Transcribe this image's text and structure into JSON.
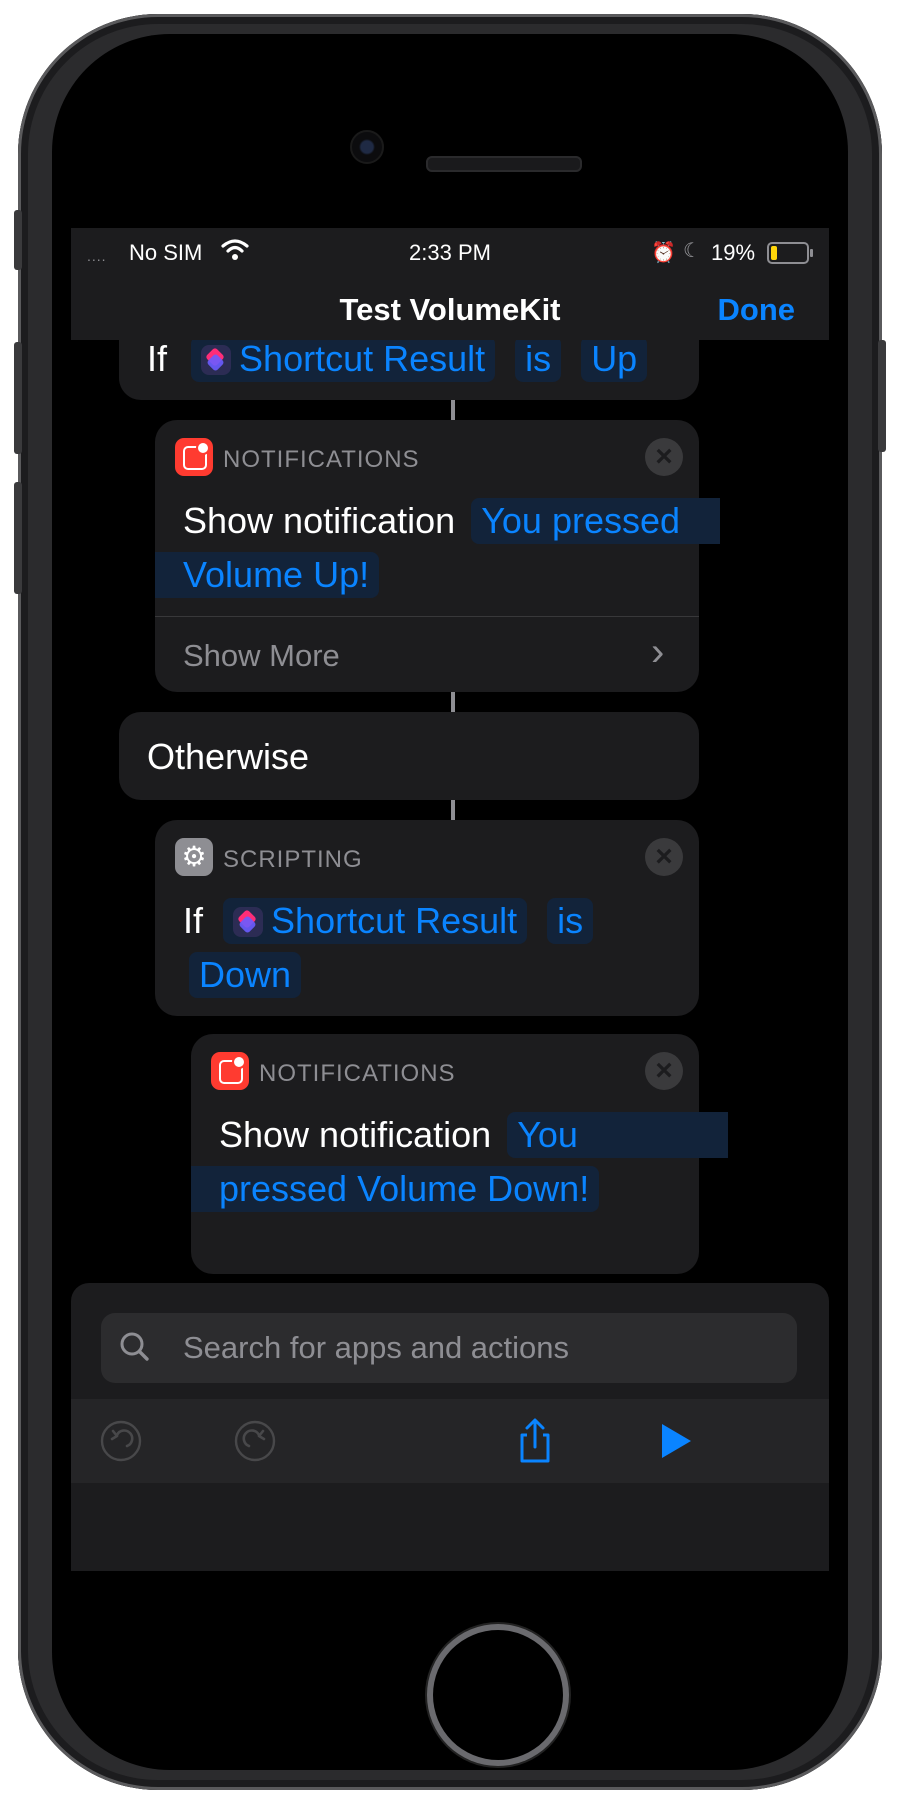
{
  "status_bar": {
    "signal": "....",
    "carrier": "No SIM",
    "time": "2:33 PM",
    "battery_percent": "19%",
    "icons": [
      "wifi-icon",
      "alarm-icon",
      "moon-icon",
      "battery-icon"
    ],
    "battery_level": 0.19
  },
  "nav": {
    "title": "Test VolumeKit",
    "done_label": "Done"
  },
  "actions": {
    "if1": {
      "keyword": "If",
      "variable": "Shortcut Result",
      "operator": "is",
      "value": "Up"
    },
    "notif1": {
      "category": "NOTIFICATIONS",
      "verb": "Show notification",
      "message_part1": "You pressed",
      "message_part2": "Volume Up!",
      "show_more": "Show More"
    },
    "otherwise": {
      "label": "Otherwise"
    },
    "if2": {
      "category": "SCRIPTING",
      "keyword": "If",
      "variable": "Shortcut Result",
      "operator": "is",
      "value": "Down"
    },
    "notif2": {
      "category": "NOTIFICATIONS",
      "verb": "Show notification",
      "message_part1": "You",
      "message_part2": "pressed Volume Down!"
    }
  },
  "search": {
    "placeholder": "Search for apps and actions"
  },
  "toolbar": {
    "icons": [
      "undo-icon",
      "redo-icon",
      "share-icon",
      "play-icon"
    ]
  },
  "colors": {
    "accent": "#0a84ff",
    "background": "#000000",
    "card": "#1c1c1e",
    "secondary_text": "#8e8e93",
    "notification_icon": "#ff3b30"
  }
}
